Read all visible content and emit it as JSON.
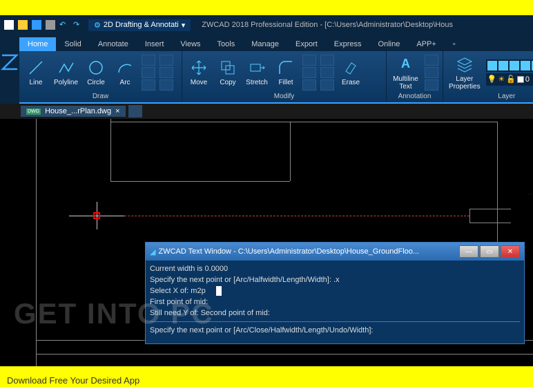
{
  "titlebar": {
    "workspace": "2D Drafting & Annotati",
    "app_title": "ZWCAD 2018 Professional Edition - [C:\\Users\\Administrator\\Desktop\\Hous"
  },
  "tabs": [
    "Home",
    "Solid",
    "Annotate",
    "Insert",
    "Views",
    "Tools",
    "Manage",
    "Export",
    "Express",
    "Online",
    "APP+"
  ],
  "active_tab": "Home",
  "panels": {
    "draw": {
      "title": "Draw",
      "items": [
        "Line",
        "Polyline",
        "Circle",
        "Arc"
      ]
    },
    "modify": {
      "title": "Modify",
      "items": [
        "Move",
        "Copy",
        "Stretch",
        "Fillet",
        "Erase"
      ]
    },
    "annotation": {
      "title": "Annotation",
      "items": [
        "Multiline Text"
      ]
    },
    "layer": {
      "title": "Layer",
      "items": [
        "Layer Properties"
      ],
      "current": "0"
    }
  },
  "doc_tab": {
    "icon": "DWG",
    "name": "House_...rPlan.dwg"
  },
  "text_window": {
    "title": "ZWCAD Text Window - C:\\Users\\Administrator\\Desktop\\House_GroundFloo...",
    "lines": [
      "Current width is 0.0000",
      "Specify the next point or [Arc/Halfwidth/Length/Width]: .x",
      "Select X of: m2p",
      "First point of mid:",
      "Still need Y of: Second point of mid:"
    ],
    "prompt": "Specify the next point or [Arc/Close/Halfwidth/Length/Undo/Width]:"
  },
  "watermark": "GET INTO PC",
  "footer": "Download Free Your Desired App"
}
